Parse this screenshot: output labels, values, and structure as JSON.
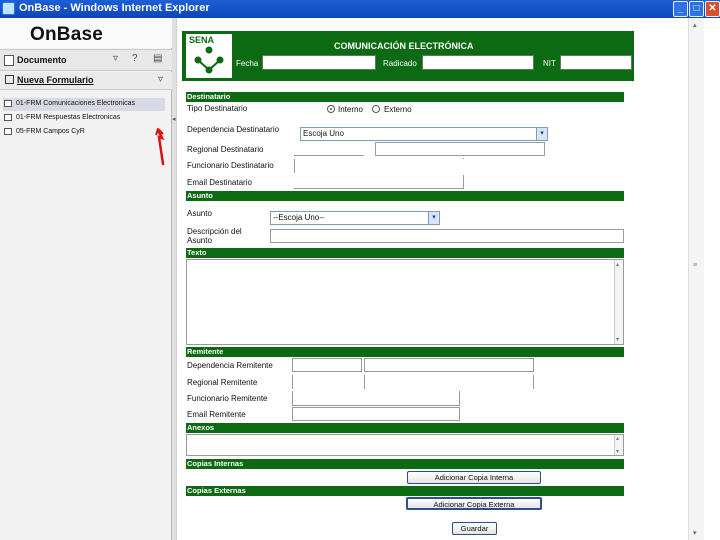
{
  "window": {
    "title": "OnBase - Windows Internet Explorer",
    "buttons": {
      "minimize": "_",
      "restore": "□",
      "close": "✕"
    }
  },
  "sidebar": {
    "logo": "OnBase",
    "documento_label": "Documento",
    "nuevo_formulario_label": "Nueva Formulario",
    "items": [
      {
        "label": "01-FRM Comunicaciones Electronicas",
        "selected": true
      },
      {
        "label": "01-FRM Respuestas Electronicas",
        "selected": false
      },
      {
        "label": "05-FRM Campos CyR",
        "selected": false
      }
    ]
  },
  "form": {
    "logo_text": "SENA",
    "title": "COMUNICACIÓN ELECTRÓNICA",
    "header_fields": {
      "fecha_label": "Fecha",
      "radicado_label": "Radicado",
      "nit_label": "NIT"
    },
    "sections": {
      "destinatario": "Destinatario",
      "asunto": "Asunto",
      "texto": "Texto",
      "remitente": "Remitente",
      "anexos": "Anexos",
      "copias_internas": "Copias Internas",
      "copias_externas": "Copias Externas"
    },
    "destinatario": {
      "tipo_label": "Tipo Destinatario",
      "interno_label": "Interno",
      "externo_label": "Externo",
      "dependencia_label": "Dependencia Destinatario",
      "dependencia_value": "Escoja Uno",
      "regional_label": "Regional Destinatario",
      "funcionario_label": "Funcionario Destinatario",
      "email_label": "Email Destinatario"
    },
    "asunto": {
      "asunto_label": "Asunto",
      "asunto_value": "--Escoja Uno--",
      "descripcion_label_1": "Descripción del",
      "descripcion_label_2": "Asunto"
    },
    "remitente": {
      "dependencia_label": "Dependencia Remitente",
      "regional_label": "Regional Remitente",
      "funcionario_label": "Funcionario Remitente",
      "email_label": "Email Remitente"
    },
    "buttons": {
      "adicionar_copia_interna": "Adicionar Copia Interna",
      "adicionar_copia_externa": "Adicionar Copia Externa",
      "guardar": "Guardar"
    }
  },
  "colors": {
    "green": "#0b6a12",
    "titlebar_blue": "#1d5fd6",
    "annotation_red": "#e01010"
  }
}
